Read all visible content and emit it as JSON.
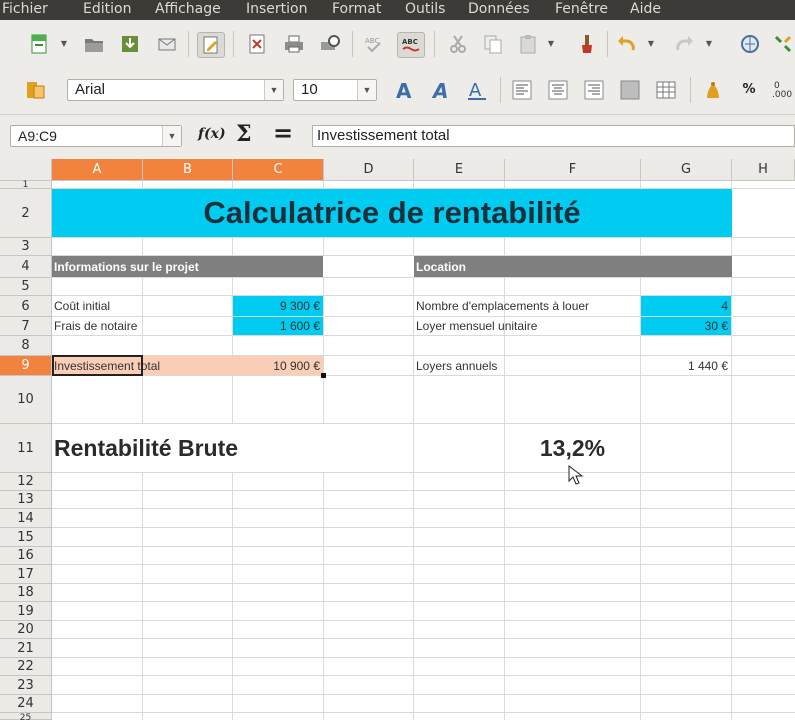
{
  "menu": [
    "Fichier",
    "Edition",
    "Affichage",
    "Insertion",
    "Format",
    "Outils",
    "Données",
    "Fenêtre",
    "Aide"
  ],
  "format_toolbar": {
    "font_name": "Arial",
    "font_size": "10",
    "percent_label": "%",
    "decimal_label": ".000"
  },
  "formula_bar": {
    "name_box": "A9:C9",
    "function_wizard_label": "f(x)",
    "sum_label": "Σ",
    "equals_label": "=",
    "content": "Investissement total"
  },
  "columns": [
    "A",
    "B",
    "C",
    "D",
    "E",
    "F",
    "G",
    "H"
  ],
  "selected_columns": [
    "A",
    "B",
    "C"
  ],
  "rows": [
    "1",
    "2",
    "3",
    "4",
    "5",
    "6",
    "7",
    "8",
    "9",
    "10",
    "11",
    "12",
    "13",
    "14",
    "15",
    "16",
    "17",
    "18",
    "19",
    "20",
    "21",
    "22",
    "23",
    "24",
    "25"
  ],
  "selected_row": "9",
  "colors": {
    "cyan_fill": "#00ccf2",
    "section_header_fill": "#7f7f7f",
    "selection_fill": "#f9cdb6",
    "header_highlight": "#f2833e"
  },
  "sheet": {
    "title": "Calculatrice de rentabilité",
    "project_header": "Informations sur le projet",
    "location_header": "Location",
    "cout_initial_label": "Coût initial",
    "cout_initial_value": "9 300 €",
    "frais_notaire_label": "Frais de notaire",
    "frais_notaire_value": "1 600 €",
    "investissement_label": "Investissement total",
    "investissement_value": "10 900 €",
    "emplacements_label": "Nombre d'emplacements à louer",
    "emplacements_value": "4",
    "loyer_mensuel_label": "Loyer mensuel unitaire",
    "loyer_mensuel_value": "30 €",
    "loyers_annuels_label": "Loyers annuels",
    "loyers_annuels_value": "1 440 €",
    "rentabilite_label": "Rentabilité Brute",
    "rentabilite_value": "13,2%"
  }
}
